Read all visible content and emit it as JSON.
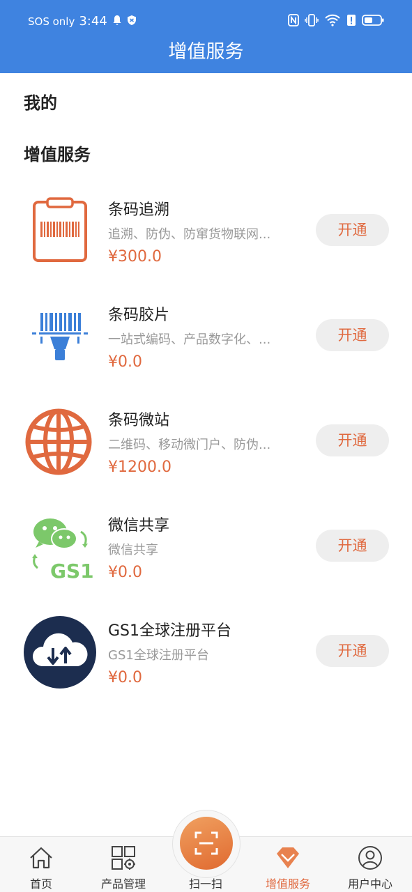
{
  "status": {
    "carrier": "SOS only",
    "time": "3:44"
  },
  "header": {
    "title": "增值服务"
  },
  "sections": {
    "mine": "我的",
    "services": "增值服务"
  },
  "services": [
    {
      "name": "条码追溯",
      "desc": "追溯、防伪、防窜货物联网...",
      "price": "¥300.0",
      "button": "开通",
      "icon": "clipboard-barcode-icon"
    },
    {
      "name": "条码胶片",
      "desc": "一站式编码、产品数字化、...",
      "price": "¥0.0",
      "button": "开通",
      "icon": "barcode-scanner-icon"
    },
    {
      "name": "条码微站",
      "desc": "二维码、移动微门户、防伪...",
      "price": "¥1200.0",
      "button": "开通",
      "icon": "globe-icon"
    },
    {
      "name": "微信共享",
      "desc": "微信共享",
      "price": "¥0.0",
      "button": "开通",
      "icon": "wechat-gs1-icon",
      "icon_text": "GS1"
    },
    {
      "name": "GS1全球注册平台",
      "desc": "GS1全球注册平台",
      "price": "¥0.0",
      "button": "开通",
      "icon": "cloud-sync-icon"
    }
  ],
  "nav": [
    {
      "label": "首页",
      "icon": "home-icon"
    },
    {
      "label": "产品管理",
      "icon": "grid-gear-icon"
    },
    {
      "label": "扫一扫",
      "icon": "scan-icon"
    },
    {
      "label": "增值服务",
      "icon": "diamond-icon",
      "active": true
    },
    {
      "label": "用户中心",
      "icon": "user-icon"
    }
  ],
  "colors": {
    "header": "#3f83e0",
    "accent": "#e0693f",
    "button_bg": "#eeeeee"
  }
}
